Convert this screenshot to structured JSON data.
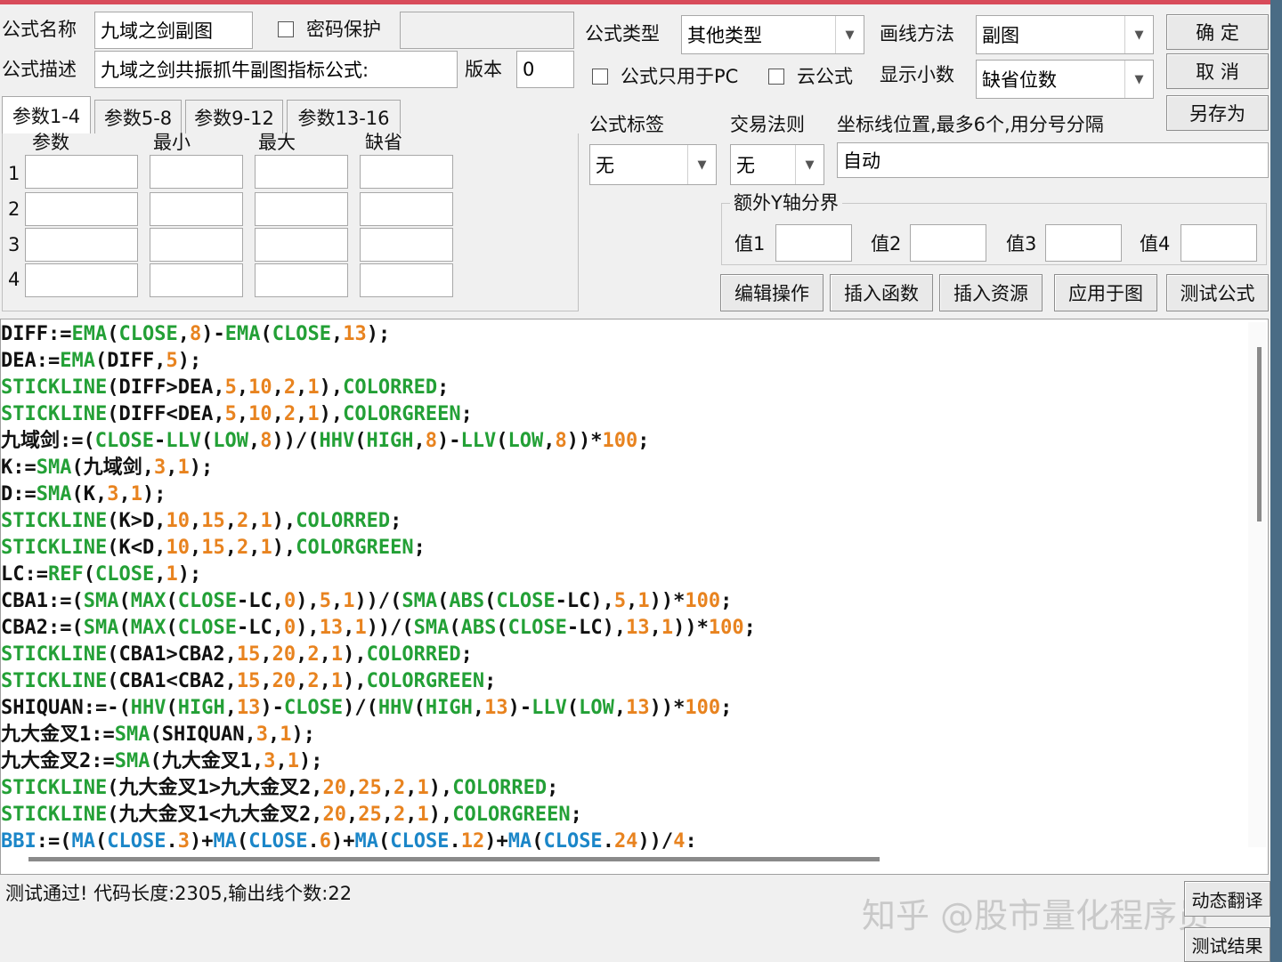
{
  "form": {
    "name_label": "公式名称",
    "name_value": "九域之剑副图",
    "password_label": "密码保护",
    "desc_label": "公式描述",
    "desc_value": "九域之剑共振抓牛副图指标公式:",
    "version_label": "版本",
    "version_value": "0",
    "type_label": "公式类型",
    "type_value": "其他类型",
    "draw_label": "画线方法",
    "draw_value": "副图",
    "pc_only_label": "公式只用于PC",
    "cloud_label": "云公式",
    "decimals_label": "显示小数",
    "decimals_value": "缺省位数",
    "tag_label": "公式标签",
    "tag_value": "无",
    "rule_label": "交易法则",
    "rule_value": "无",
    "axis_label": "坐标线位置,最多6个,用分号分隔",
    "axis_value": "自动",
    "extra_y_label": "额外Y轴分界",
    "val1_label": "值1",
    "val2_label": "值2",
    "val3_label": "值3",
    "val4_label": "值4"
  },
  "buttons": {
    "ok": "确 定",
    "cancel": "取 消",
    "save_as": "另存为",
    "edit_ops": "编辑操作",
    "insert_func": "插入函数",
    "insert_res": "插入资源",
    "apply_chart": "应用于图",
    "test_formula": "测试公式",
    "translate": "动态翻译",
    "test_result": "测试结果"
  },
  "tabs": [
    "参数1-4",
    "参数5-8",
    "参数9-12",
    "参数13-16"
  ],
  "params": {
    "headers": [
      "参数",
      "最小",
      "最大",
      "缺省"
    ],
    "rows": [
      "1",
      "2",
      "3",
      "4"
    ]
  },
  "code_lines": [
    [
      [
        "v",
        "DIFF:="
      ],
      [
        "f",
        "EMA"
      ],
      [
        "v",
        "("
      ],
      [
        "f",
        "CLOSE"
      ],
      [
        "v",
        ","
      ],
      [
        "n",
        "8"
      ],
      [
        "v",
        ")-"
      ],
      [
        "f",
        "EMA"
      ],
      [
        "v",
        "("
      ],
      [
        "f",
        "CLOSE"
      ],
      [
        "v",
        ","
      ],
      [
        "n",
        "13"
      ],
      [
        "v",
        ");"
      ]
    ],
    [
      [
        "v",
        "DEA:="
      ],
      [
        "f",
        "EMA"
      ],
      [
        "v",
        "(DIFF,"
      ],
      [
        "n",
        "5"
      ],
      [
        "v",
        ");"
      ]
    ],
    [
      [
        "f",
        "STICKLINE"
      ],
      [
        "v",
        "(DIFF>DEA,"
      ],
      [
        "n",
        "5"
      ],
      [
        "v",
        ","
      ],
      [
        "n",
        "10"
      ],
      [
        "v",
        ","
      ],
      [
        "n",
        "2"
      ],
      [
        "v",
        ","
      ],
      [
        "n",
        "1"
      ],
      [
        "v",
        "),"
      ],
      [
        "f",
        "COLORRED"
      ],
      [
        "v",
        ";"
      ]
    ],
    [
      [
        "f",
        "STICKLINE"
      ],
      [
        "v",
        "(DIFF<DEA,"
      ],
      [
        "n",
        "5"
      ],
      [
        "v",
        ","
      ],
      [
        "n",
        "10"
      ],
      [
        "v",
        ","
      ],
      [
        "n",
        "2"
      ],
      [
        "v",
        ","
      ],
      [
        "n",
        "1"
      ],
      [
        "v",
        "),"
      ],
      [
        "f",
        "COLORGREEN"
      ],
      [
        "v",
        ";"
      ]
    ],
    [
      [
        "v",
        "九域剑:=("
      ],
      [
        "f",
        "CLOSE"
      ],
      [
        "v",
        "-"
      ],
      [
        "f",
        "LLV"
      ],
      [
        "v",
        "("
      ],
      [
        "f",
        "LOW"
      ],
      [
        "v",
        ","
      ],
      [
        "n",
        "8"
      ],
      [
        "v",
        "))/("
      ],
      [
        "f",
        "HHV"
      ],
      [
        "v",
        "("
      ],
      [
        "f",
        "HIGH"
      ],
      [
        "v",
        ","
      ],
      [
        "n",
        "8"
      ],
      [
        "v",
        ")-"
      ],
      [
        "f",
        "LLV"
      ],
      [
        "v",
        "("
      ],
      [
        "f",
        "LOW"
      ],
      [
        "v",
        ","
      ],
      [
        "n",
        "8"
      ],
      [
        "v",
        "))*"
      ],
      [
        "n",
        "100"
      ],
      [
        "v",
        ";"
      ]
    ],
    [
      [
        "v",
        "K:="
      ],
      [
        "f",
        "SMA"
      ],
      [
        "v",
        "(九域剑,"
      ],
      [
        "n",
        "3"
      ],
      [
        "v",
        ","
      ],
      [
        "n",
        "1"
      ],
      [
        "v",
        ");"
      ]
    ],
    [
      [
        "v",
        "D:="
      ],
      [
        "f",
        "SMA"
      ],
      [
        "v",
        "(K,"
      ],
      [
        "n",
        "3"
      ],
      [
        "v",
        ","
      ],
      [
        "n",
        "1"
      ],
      [
        "v",
        ");"
      ]
    ],
    [
      [
        "f",
        "STICKLINE"
      ],
      [
        "v",
        "(K>D,"
      ],
      [
        "n",
        "10"
      ],
      [
        "v",
        ","
      ],
      [
        "n",
        "15"
      ],
      [
        "v",
        ","
      ],
      [
        "n",
        "2"
      ],
      [
        "v",
        ","
      ],
      [
        "n",
        "1"
      ],
      [
        "v",
        "),"
      ],
      [
        "f",
        "COLORRED"
      ],
      [
        "v",
        ";"
      ]
    ],
    [
      [
        "f",
        "STICKLINE"
      ],
      [
        "v",
        "(K<D,"
      ],
      [
        "n",
        "10"
      ],
      [
        "v",
        ","
      ],
      [
        "n",
        "15"
      ],
      [
        "v",
        ","
      ],
      [
        "n",
        "2"
      ],
      [
        "v",
        ","
      ],
      [
        "n",
        "1"
      ],
      [
        "v",
        "),"
      ],
      [
        "f",
        "COLORGREEN"
      ],
      [
        "v",
        ";"
      ]
    ],
    [
      [
        "v",
        "LC:="
      ],
      [
        "f",
        "REF"
      ],
      [
        "v",
        "("
      ],
      [
        "f",
        "CLOSE"
      ],
      [
        "v",
        ","
      ],
      [
        "n",
        "1"
      ],
      [
        "v",
        ");"
      ]
    ],
    [
      [
        "v",
        "CBA1:=("
      ],
      [
        "f",
        "SMA"
      ],
      [
        "v",
        "("
      ],
      [
        "f",
        "MAX"
      ],
      [
        "v",
        "("
      ],
      [
        "f",
        "CLOSE"
      ],
      [
        "v",
        "-LC,"
      ],
      [
        "n",
        "0"
      ],
      [
        "v",
        "),"
      ],
      [
        "n",
        "5"
      ],
      [
        "v",
        ","
      ],
      [
        "n",
        "1"
      ],
      [
        "v",
        "))/("
      ],
      [
        "f",
        "SMA"
      ],
      [
        "v",
        "("
      ],
      [
        "f",
        "ABS"
      ],
      [
        "v",
        "("
      ],
      [
        "f",
        "CLOSE"
      ],
      [
        "v",
        "-LC),"
      ],
      [
        "n",
        "5"
      ],
      [
        "v",
        ","
      ],
      [
        "n",
        "1"
      ],
      [
        "v",
        "))*"
      ],
      [
        "n",
        "100"
      ],
      [
        "v",
        ";"
      ]
    ],
    [
      [
        "v",
        "CBA2:=("
      ],
      [
        "f",
        "SMA"
      ],
      [
        "v",
        "("
      ],
      [
        "f",
        "MAX"
      ],
      [
        "v",
        "("
      ],
      [
        "f",
        "CLOSE"
      ],
      [
        "v",
        "-LC,"
      ],
      [
        "n",
        "0"
      ],
      [
        "v",
        "),"
      ],
      [
        "n",
        "13"
      ],
      [
        "v",
        ","
      ],
      [
        "n",
        "1"
      ],
      [
        "v",
        "))/("
      ],
      [
        "f",
        "SMA"
      ],
      [
        "v",
        "("
      ],
      [
        "f",
        "ABS"
      ],
      [
        "v",
        "("
      ],
      [
        "f",
        "CLOSE"
      ],
      [
        "v",
        "-LC),"
      ],
      [
        "n",
        "13"
      ],
      [
        "v",
        ","
      ],
      [
        "n",
        "1"
      ],
      [
        "v",
        "))*"
      ],
      [
        "n",
        "100"
      ],
      [
        "v",
        ";"
      ]
    ],
    [
      [
        "f",
        "STICKLINE"
      ],
      [
        "v",
        "(CBA1>CBA2,"
      ],
      [
        "n",
        "15"
      ],
      [
        "v",
        ","
      ],
      [
        "n",
        "20"
      ],
      [
        "v",
        ","
      ],
      [
        "n",
        "2"
      ],
      [
        "v",
        ","
      ],
      [
        "n",
        "1"
      ],
      [
        "v",
        "),"
      ],
      [
        "f",
        "COLORRED"
      ],
      [
        "v",
        ";"
      ]
    ],
    [
      [
        "f",
        "STICKLINE"
      ],
      [
        "v",
        "(CBA1<CBA2,"
      ],
      [
        "n",
        "15"
      ],
      [
        "v",
        ","
      ],
      [
        "n",
        "20"
      ],
      [
        "v",
        ","
      ],
      [
        "n",
        "2"
      ],
      [
        "v",
        ","
      ],
      [
        "n",
        "1"
      ],
      [
        "v",
        "),"
      ],
      [
        "f",
        "COLORGREEN"
      ],
      [
        "v",
        ";"
      ]
    ],
    [
      [
        "v",
        "SHIQUAN:=-("
      ],
      [
        "f",
        "HHV"
      ],
      [
        "v",
        "("
      ],
      [
        "f",
        "HIGH"
      ],
      [
        "v",
        ","
      ],
      [
        "n",
        "13"
      ],
      [
        "v",
        ")-"
      ],
      [
        "f",
        "CLOSE"
      ],
      [
        "v",
        ")/("
      ],
      [
        "f",
        "HHV"
      ],
      [
        "v",
        "("
      ],
      [
        "f",
        "HIGH"
      ],
      [
        "v",
        ","
      ],
      [
        "n",
        "13"
      ],
      [
        "v",
        ")-"
      ],
      [
        "f",
        "LLV"
      ],
      [
        "v",
        "("
      ],
      [
        "f",
        "LOW"
      ],
      [
        "v",
        ","
      ],
      [
        "n",
        "13"
      ],
      [
        "v",
        "))*"
      ],
      [
        "n",
        "100"
      ],
      [
        "v",
        ";"
      ]
    ],
    [
      [
        "v",
        "九大金叉1:="
      ],
      [
        "f",
        "SMA"
      ],
      [
        "v",
        "(SHIQUAN,"
      ],
      [
        "n",
        "3"
      ],
      [
        "v",
        ","
      ],
      [
        "n",
        "1"
      ],
      [
        "v",
        ");"
      ]
    ],
    [
      [
        "v",
        "九大金叉2:="
      ],
      [
        "f",
        "SMA"
      ],
      [
        "v",
        "(九大金叉1,"
      ],
      [
        "n",
        "3"
      ],
      [
        "v",
        ","
      ],
      [
        "n",
        "1"
      ],
      [
        "v",
        ");"
      ]
    ],
    [
      [
        "f",
        "STICKLINE"
      ],
      [
        "v",
        "(九大金叉1>九大金叉2,"
      ],
      [
        "n",
        "20"
      ],
      [
        "v",
        ","
      ],
      [
        "n",
        "25"
      ],
      [
        "v",
        ","
      ],
      [
        "n",
        "2"
      ],
      [
        "v",
        ","
      ],
      [
        "n",
        "1"
      ],
      [
        "v",
        "),"
      ],
      [
        "f",
        "COLORRED"
      ],
      [
        "v",
        ";"
      ]
    ],
    [
      [
        "f",
        "STICKLINE"
      ],
      [
        "v",
        "(九大金叉1<九大金叉2,"
      ],
      [
        "n",
        "20"
      ],
      [
        "v",
        ","
      ],
      [
        "n",
        "25"
      ],
      [
        "v",
        ","
      ],
      [
        "n",
        "2"
      ],
      [
        "v",
        ","
      ],
      [
        "n",
        "1"
      ],
      [
        "v",
        "),"
      ],
      [
        "f",
        "COLORGREEN"
      ],
      [
        "v",
        ";"
      ]
    ],
    [
      [
        "b",
        "BBI"
      ],
      [
        "v",
        ":=("
      ],
      [
        "b",
        "MA"
      ],
      [
        "v",
        "("
      ],
      [
        "b",
        "CLOSE"
      ],
      [
        "v",
        "."
      ],
      [
        "n",
        "3"
      ],
      [
        "v",
        ")+"
      ],
      [
        "b",
        "MA"
      ],
      [
        "v",
        "("
      ],
      [
        "b",
        "CLOSE"
      ],
      [
        "v",
        "."
      ],
      [
        "n",
        "6"
      ],
      [
        "v",
        ")+"
      ],
      [
        "b",
        "MA"
      ],
      [
        "v",
        "("
      ],
      [
        "b",
        "CLOSE"
      ],
      [
        "v",
        "."
      ],
      [
        "n",
        "12"
      ],
      [
        "v",
        ")+"
      ],
      [
        "b",
        "MA"
      ],
      [
        "v",
        "("
      ],
      [
        "b",
        "CLOSE"
      ],
      [
        "v",
        "."
      ],
      [
        "n",
        "24"
      ],
      [
        "v",
        "))/"
      ],
      [
        "n",
        "4"
      ],
      [
        "v",
        ":"
      ]
    ]
  ],
  "status": "测试通过! 代码长度:2305,输出线个数:22",
  "watermark": "知乎 @股市量化程序员",
  "colors": {
    "function": "#23a036",
    "number": "#e8831f",
    "blue": "#1b86c8",
    "text": "#111111"
  }
}
